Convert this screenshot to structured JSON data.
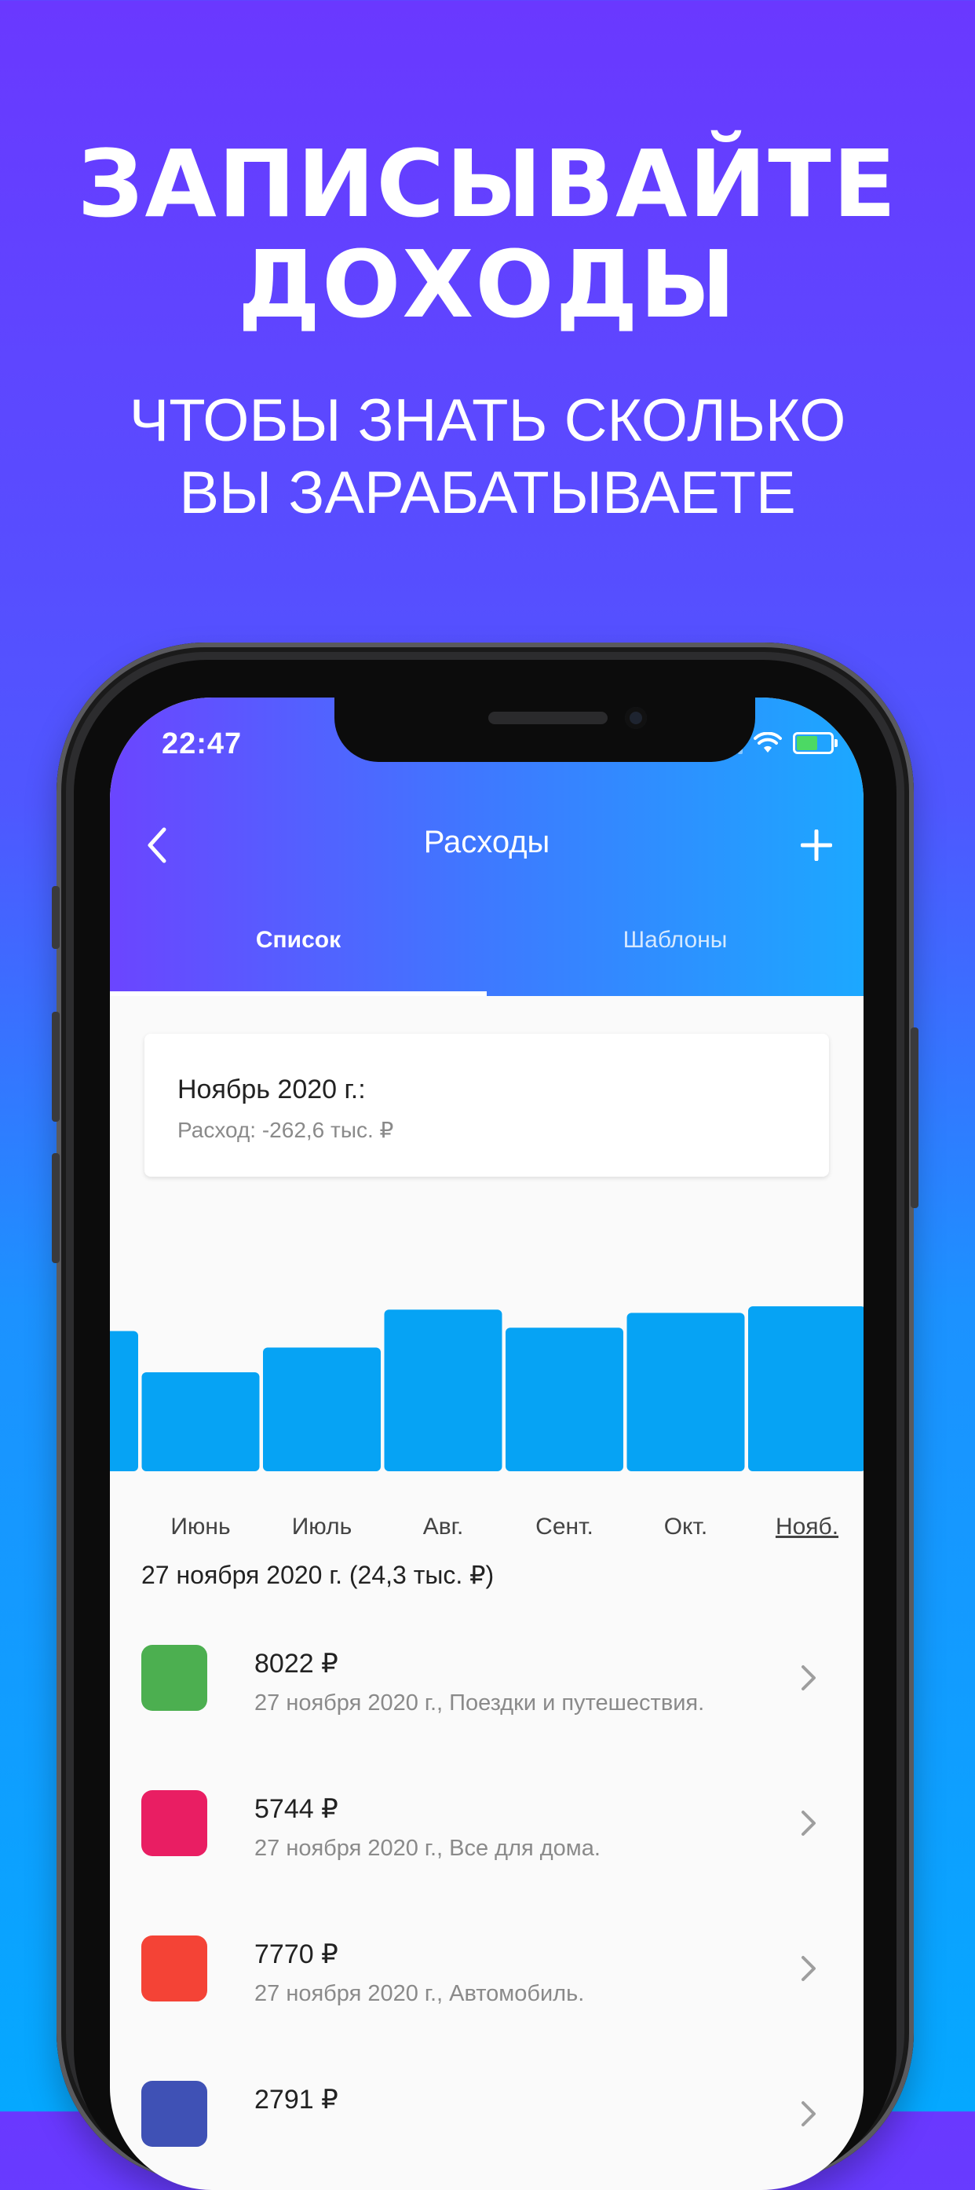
{
  "promo": {
    "title_line1": "ЗАПИСЫВАЙТЕ",
    "title_line2": "ДОХОДЫ",
    "subtitle_line1": "ЧТОБЫ ЗНАТЬ СКОЛЬКО",
    "subtitle_line2": "ВЫ ЗАРАБАТЫВАЕТЕ"
  },
  "status_bar": {
    "time": "22:47"
  },
  "header": {
    "title": "Расходы",
    "back_icon": "chevron-left-icon",
    "add_icon": "plus-icon"
  },
  "tabs": [
    {
      "label": "Список",
      "active": true
    },
    {
      "label": "Шаблоны",
      "active": false
    }
  ],
  "summary": {
    "title": "Ноябрь 2020 г.:",
    "expense": "Расход: -262,6 тыс. ₽"
  },
  "chart_data": {
    "type": "bar",
    "categories": [
      "",
      "Июнь",
      "Июль",
      "Авг.",
      "Сент.",
      "Окт.",
      "Нояб."
    ],
    "values": [
      0.85,
      0.6,
      0.75,
      0.98,
      0.87,
      0.96,
      1.0
    ],
    "selected": "Нояб.",
    "bar_color": "#06a3f4",
    "title": "",
    "xlabel": "",
    "ylabel": ""
  },
  "day": {
    "header": "27 ноября 2020 г. (24,3 тыс. ₽)"
  },
  "transactions": [
    {
      "amount": "8022 ₽",
      "desc": "27 ноября 2020 г., Поездки и путешествия.",
      "color": "#4caf50"
    },
    {
      "amount": "5744 ₽",
      "desc": "27 ноября 2020 г., Все для дома.",
      "color": "#e91e63"
    },
    {
      "amount": "7770 ₽",
      "desc": "27 ноября 2020 г., Автомобиль.",
      "color": "#f44336"
    },
    {
      "amount": "2791 ₽",
      "desc": "",
      "color": "#3f51b5"
    }
  ],
  "colors": {
    "header_start": "#6b45ff",
    "header_end": "#1ca8ff",
    "chart_bar": "#06a3f4"
  }
}
